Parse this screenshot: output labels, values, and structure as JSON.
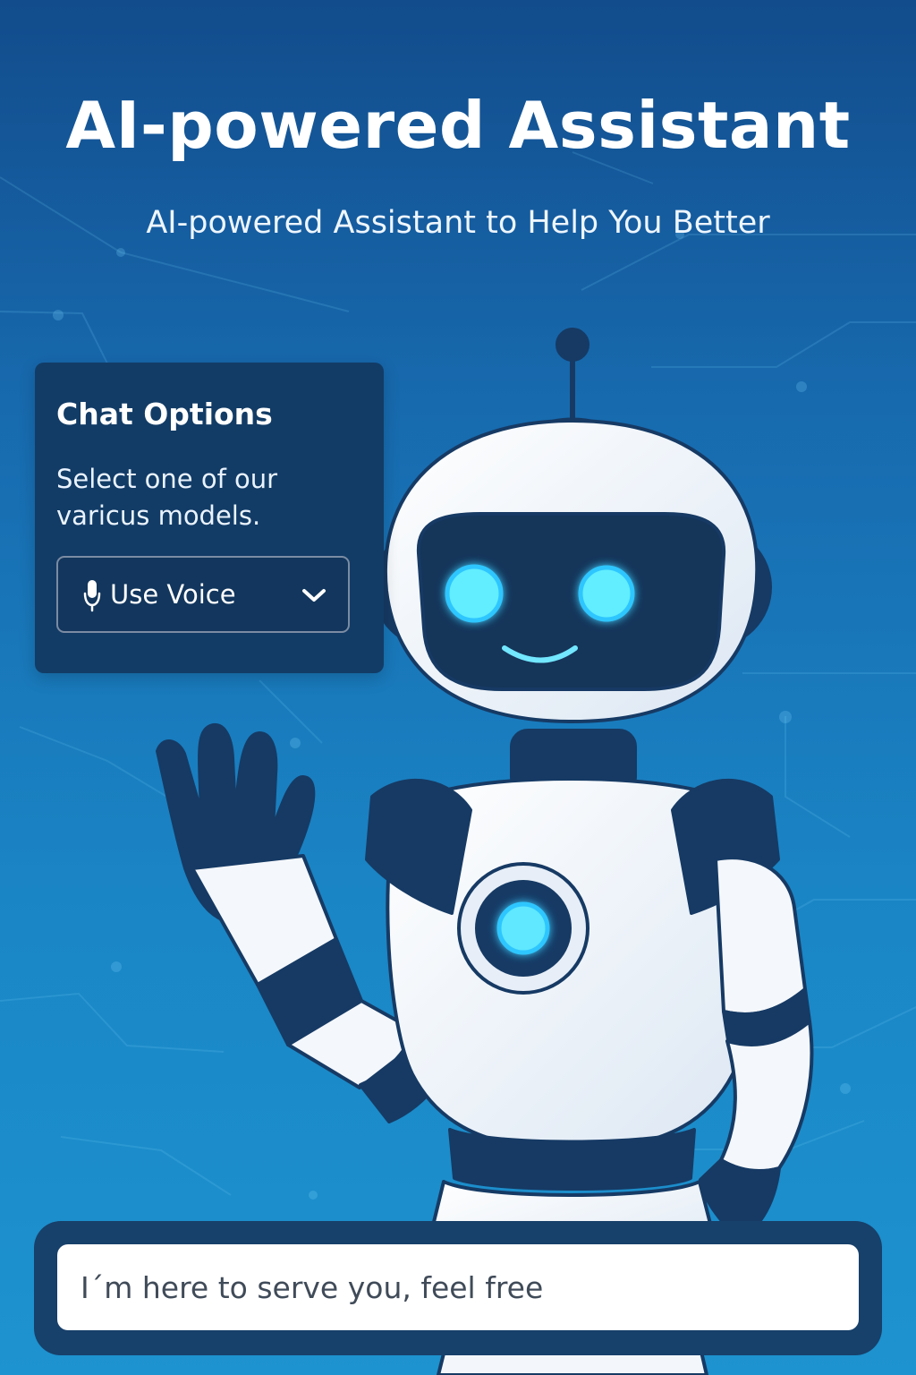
{
  "hero": {
    "title": "AI-powered Assistant",
    "subtitle": "AI-powered Assistant to Help You Better"
  },
  "chat_options": {
    "title": "Chat Options",
    "description": "Select one of our varicus models.",
    "selected_mode": "Use Voice",
    "icon": "microphone-icon",
    "dropdown_icon": "chevron-down-icon"
  },
  "chat_input": {
    "placeholder": "I´m here to serve you, feel free",
    "value": ""
  },
  "colors": {
    "background_top": "#124c8c",
    "background_bottom": "#1d93cf",
    "panel": "#123c66",
    "robot_navy": "#163a64",
    "robot_white": "#f5f8fc",
    "robot_glow": "#5ee8ff"
  }
}
